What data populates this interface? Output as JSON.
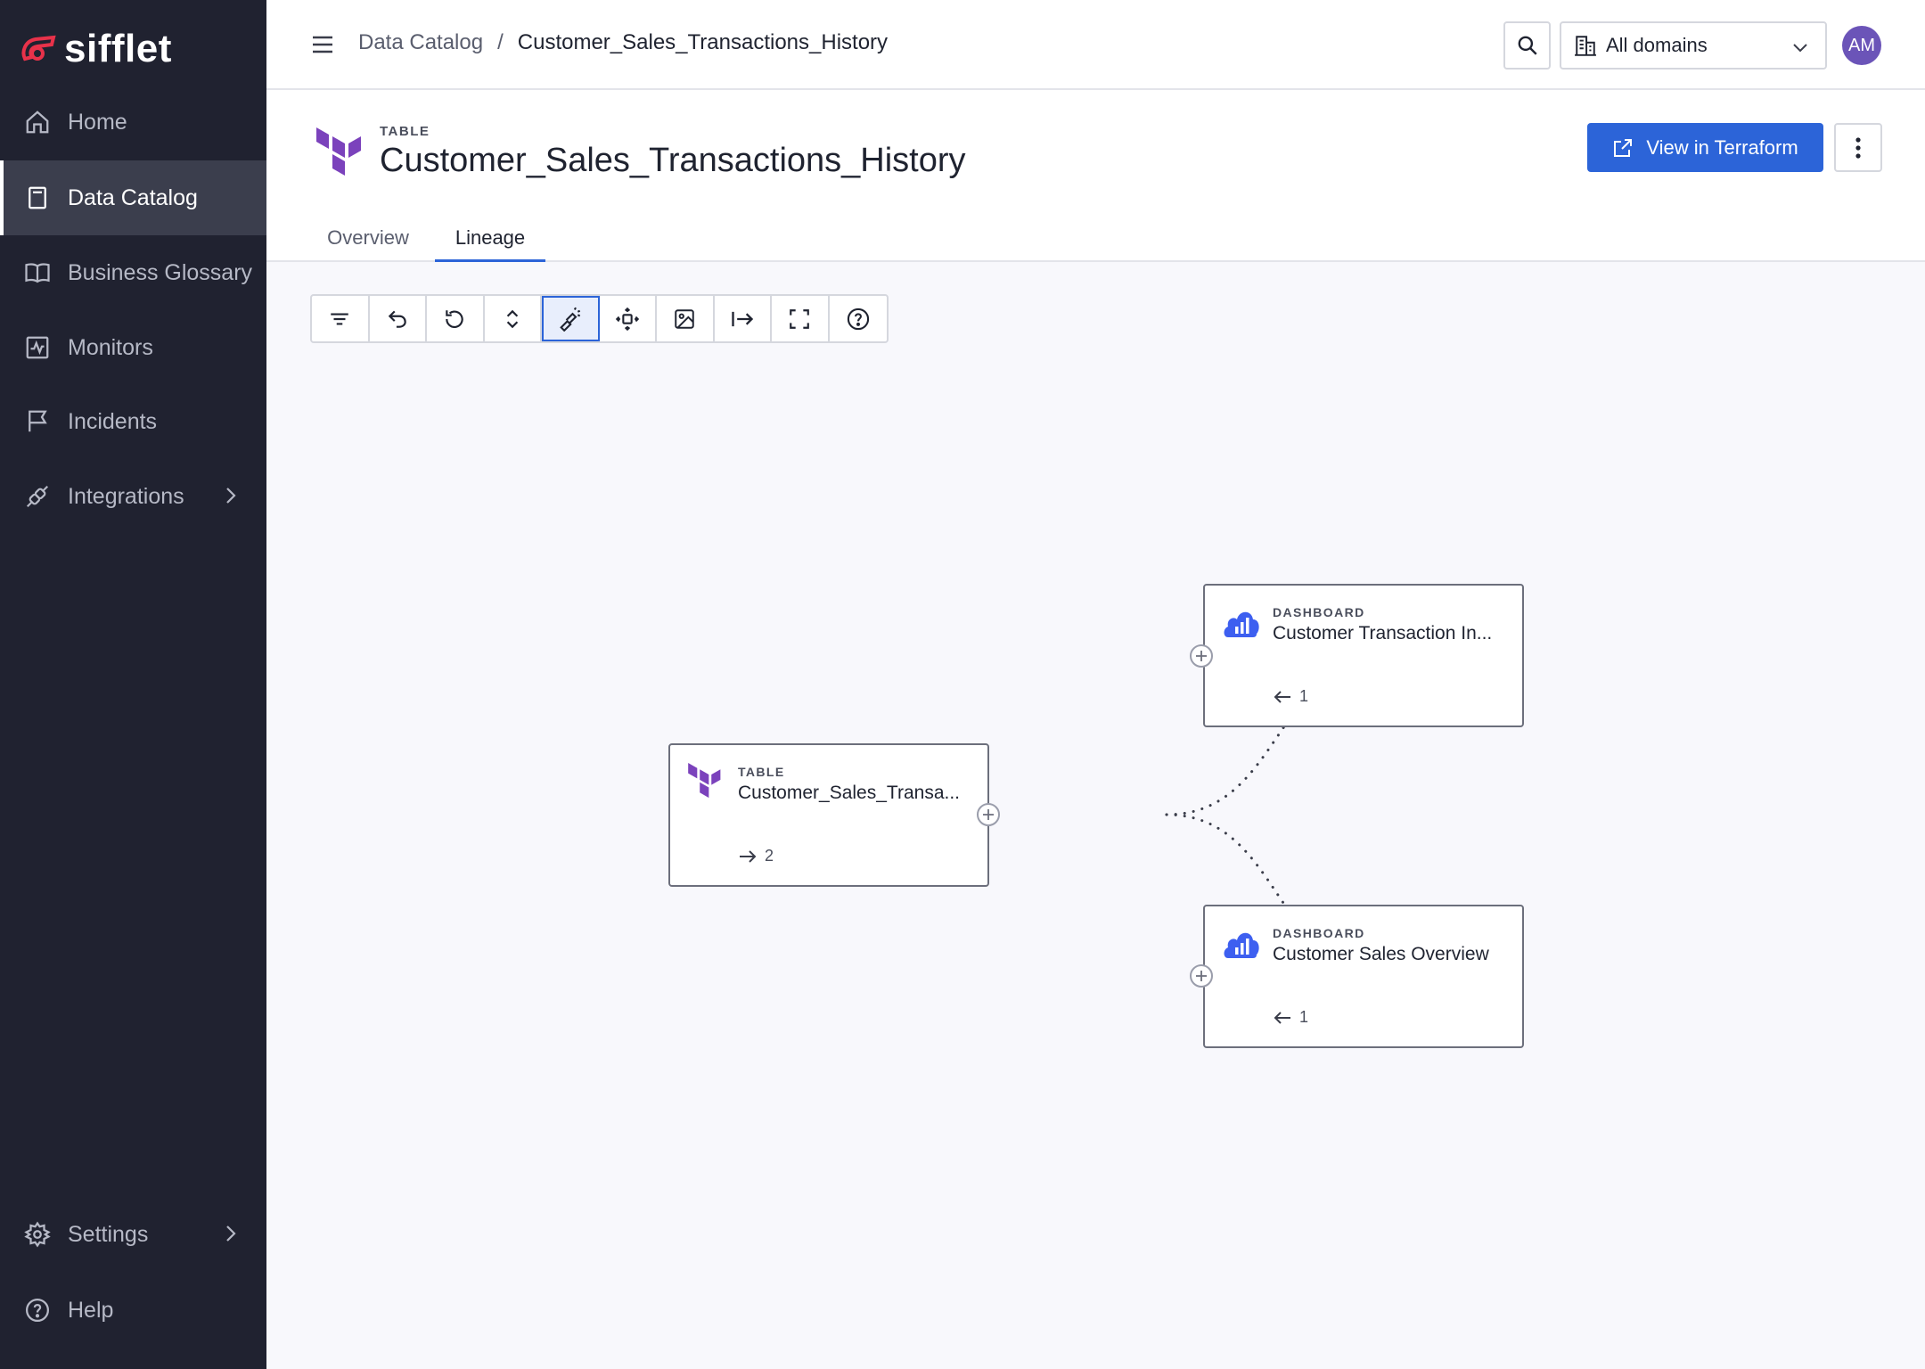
{
  "app": {
    "logo_text": "sifflet"
  },
  "sidebar": {
    "items": [
      {
        "label": "Home",
        "icon": "home-icon"
      },
      {
        "label": "Data Catalog",
        "icon": "book-icon",
        "active": true
      },
      {
        "label": "Business Glossary",
        "icon": "open-book-icon"
      },
      {
        "label": "Monitors",
        "icon": "activity-icon"
      },
      {
        "label": "Incidents",
        "icon": "flag-icon"
      },
      {
        "label": "Integrations",
        "icon": "plug-icon",
        "has_submenu": true
      }
    ],
    "bottom_items": [
      {
        "label": "Settings",
        "icon": "gear-icon",
        "has_submenu": true
      },
      {
        "label": "Help",
        "icon": "help-icon"
      }
    ]
  },
  "header": {
    "breadcrumb": {
      "root": "Data Catalog",
      "separator": "/",
      "current": "Customer_Sales_Transactions_History"
    },
    "domain_select": {
      "value": "All domains"
    },
    "avatar_initials": "AM"
  },
  "entity": {
    "type": "TABLE",
    "title": "Customer_Sales_Transactions_History",
    "primary_action": "View in Terraform"
  },
  "tabs": [
    {
      "label": "Overview",
      "active": false
    },
    {
      "label": "Lineage",
      "active": true
    }
  ],
  "toolbar": {
    "tools": [
      {
        "name": "filter-icon"
      },
      {
        "name": "undo-icon"
      },
      {
        "name": "reset-icon"
      },
      {
        "name": "expand-collapse-icon"
      },
      {
        "name": "highlight-icon",
        "active": true
      },
      {
        "name": "recenter-icon"
      },
      {
        "name": "image-export-icon"
      },
      {
        "name": "expand-right-icon"
      },
      {
        "name": "fullscreen-icon"
      },
      {
        "name": "help-icon"
      }
    ]
  },
  "lineage": {
    "source": {
      "type": "TABLE",
      "name": "Customer_Sales_Transa...",
      "downstream_count": "2"
    },
    "targets": [
      {
        "type": "DASHBOARD",
        "name": "Customer Transaction In...",
        "upstream_count": "1"
      },
      {
        "type": "DASHBOARD",
        "name": "Customer Sales Overview",
        "upstream_count": "1"
      }
    ]
  },
  "colors": {
    "sidebar_bg": "#202230",
    "accent": "#2c64d8",
    "terraform_purple": "#7b42bc",
    "dashboard_blue": "#3d5ff0",
    "avatar": "#6b54b8"
  }
}
